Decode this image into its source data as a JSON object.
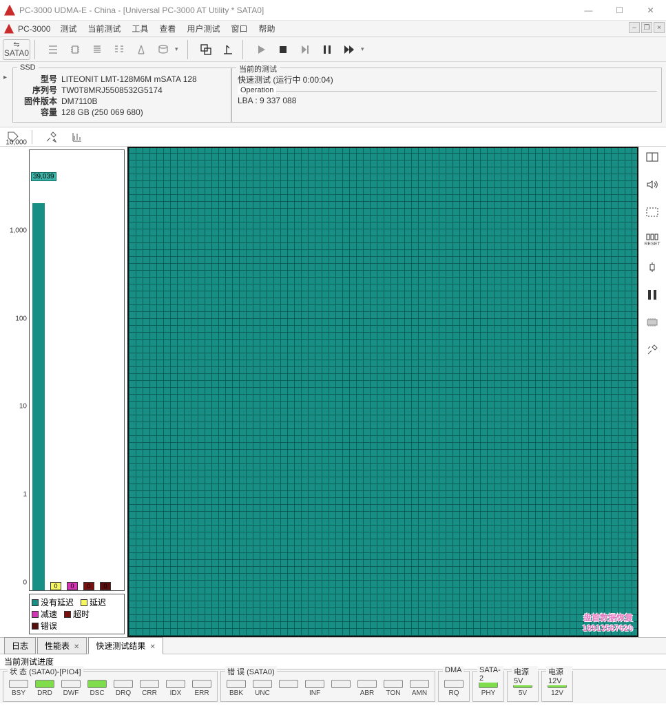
{
  "window": {
    "title": "PC-3000 UDMA-E - China - [Universal PC-3000 AT Utility * SATA0]",
    "app_label": "PC-3000"
  },
  "menu": [
    "测试",
    "当前测试",
    "工具",
    "查看",
    "用户测试",
    "窗口",
    "帮助"
  ],
  "toolbar": {
    "sata_label": "SATA0"
  },
  "device": {
    "group": "SSD",
    "labels": {
      "model": "型号",
      "serial": "序列号",
      "fw": "固件版本",
      "capacity": "容量"
    },
    "model": "LITEONIT LMT-128M6M mSATA 128",
    "serial": "TW0T8MRJ5508532G5174",
    "fw": "DM7110B",
    "capacity": "128 GB (250 069 680)"
  },
  "test": {
    "group": "当前的测试",
    "status": "快速测试 (运行中 0:00:04)",
    "op_label": "Operation",
    "lba": "LBA : 9 337 088"
  },
  "chart_data": {
    "type": "bar",
    "yscale": "log",
    "yticks": [
      "0",
      "1",
      "10",
      "100",
      "1,000",
      "10,000"
    ],
    "series": [
      {
        "name": "main",
        "value": 39039,
        "label": "39,039",
        "color": "#188f85"
      }
    ],
    "category_bars": [
      {
        "color": "#f7f763",
        "value": 0
      },
      {
        "color": "#d336b3",
        "value": 0
      },
      {
        "color": "#7a1111",
        "value": 0
      },
      {
        "color": "#5a0d0d",
        "value": 0
      }
    ],
    "legend": [
      {
        "label": "没有延迟",
        "color": "#188f85"
      },
      {
        "label": "延迟",
        "color": "#f7f763"
      },
      {
        "label": "减速",
        "color": "#d336b3"
      },
      {
        "label": "超时",
        "color": "#7a1111"
      },
      {
        "label": "错误",
        "color": "#5a0d0d"
      }
    ]
  },
  "tabs": {
    "items": [
      "日志",
      "性能表",
      "快速测试结果"
    ],
    "active": 2
  },
  "progress": {
    "label": "当前测试进度"
  },
  "status": {
    "group1": {
      "title": "状 态 (SATA0)-[PIO4]",
      "leds": [
        {
          "l": "BSY",
          "on": 0
        },
        {
          "l": "DRD",
          "on": 1
        },
        {
          "l": "DWF",
          "on": 0
        },
        {
          "l": "DSC",
          "on": 1
        },
        {
          "l": "DRQ",
          "on": 0
        },
        {
          "l": "CRR",
          "on": 0
        },
        {
          "l": "IDX",
          "on": 0
        },
        {
          "l": "ERR",
          "on": 0
        }
      ]
    },
    "group2": {
      "title": "错 误 (SATA0)",
      "leds": [
        {
          "l": "BBK",
          "on": 0
        },
        {
          "l": "UNC",
          "on": 0
        },
        {
          "l": "",
          "on": 0
        },
        {
          "l": "INF",
          "on": 0
        },
        {
          "l": "",
          "on": 0
        },
        {
          "l": "ABR",
          "on": 0
        },
        {
          "l": "TON",
          "on": 0
        },
        {
          "l": "AMN",
          "on": 0
        }
      ]
    },
    "group3": {
      "title": "DMA",
      "leds": [
        {
          "l": "RQ",
          "on": 0
        }
      ]
    },
    "group4": {
      "title": "SATA-2",
      "leds": [
        {
          "l": "PHY",
          "on": 1
        }
      ]
    },
    "group5": {
      "title": "电源 5V",
      "leds": [
        {
          "l": "5V",
          "on": 1
        }
      ]
    },
    "group6": {
      "title": "电源 12V",
      "leds": [
        {
          "l": "12V",
          "on": 1
        }
      ]
    }
  },
  "side": {
    "reset": "RESET"
  },
  "watermark": {
    "l1": "盘首数据恢复",
    "l2": "18913587620"
  }
}
